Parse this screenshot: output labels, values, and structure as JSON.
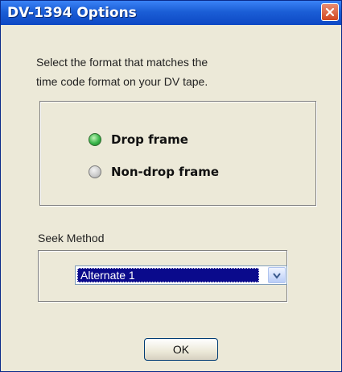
{
  "window": {
    "title": "DV-1394 Options",
    "close_icon": "close-icon"
  },
  "instructions": {
    "line1": "Select the format that matches the",
    "line2": "time code format on your DV tape."
  },
  "format_options": [
    {
      "label": "Drop frame",
      "selected": true
    },
    {
      "label": "Non-drop frame",
      "selected": false
    }
  ],
  "seek": {
    "label": "Seek Method",
    "value": "Alternate 1",
    "dropdown_icon": "chevron-down-icon"
  },
  "buttons": {
    "ok": "OK"
  },
  "colors": {
    "titlebar": "#1b5ed6",
    "close": "#d2461f",
    "selection": "#0a0a8c",
    "radio_on": "#39b54a"
  }
}
